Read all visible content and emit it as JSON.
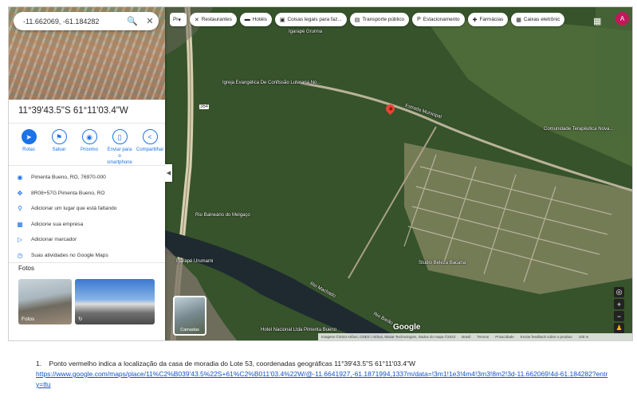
{
  "search": {
    "query": "-11.662069, -61.184282",
    "search_icon": "search-icon",
    "close_icon": "close-icon"
  },
  "place": {
    "title": "11°39'43.5\"S 61°11'03.4\"W"
  },
  "actions": [
    {
      "label": "Rotas",
      "icon": "directions-icon"
    },
    {
      "label": "Salvar",
      "icon": "bookmark-icon"
    },
    {
      "label": "Próximo",
      "icon": "nearby-icon"
    },
    {
      "label": "Enviar para o smartphone",
      "icon": "send-phone-icon"
    },
    {
      "label": "Compartilhar",
      "icon": "share-icon"
    }
  ],
  "info_rows": [
    {
      "text": "Pimenta Bueno, RO, 76970-000",
      "icon": "location-pin-icon"
    },
    {
      "text": "8R08+57G Pimenta Bueno, RO",
      "icon": "plus-code-icon"
    },
    {
      "text": "Adicionar um lugar que está faltando",
      "icon": "add-place-icon"
    },
    {
      "text": "Adicione sua empresa",
      "icon": "business-icon"
    },
    {
      "text": "Adicionar marcador",
      "icon": "label-icon"
    },
    {
      "text": "Suas atividades no Google Maps",
      "icon": "history-icon"
    }
  ],
  "photos": {
    "heading": "Fotos",
    "thumb1": "Fotos",
    "thumb2": ""
  },
  "chips": [
    {
      "label": "Restaurantes",
      "icon": "restaurant-icon"
    },
    {
      "label": "Hotéis",
      "icon": "hotel-icon"
    },
    {
      "label": "Coisas legais para faz...",
      "icon": "attractions-icon"
    },
    {
      "label": "Transporte público",
      "icon": "transit-icon"
    },
    {
      "label": "Estacionamento",
      "icon": "parking-icon"
    },
    {
      "label": "Farmácias",
      "icon": "pharmacy-icon"
    },
    {
      "label": "Caixas eletrônic",
      "icon": "atm-icon"
    }
  ],
  "chip_first": "Pr",
  "avatar": "A",
  "map_labels": {
    "igreja": "Igreja Evangélica De Confissão Luterana No...",
    "igarape_grunna": "Igarapé Grunna",
    "estrada": "Estrada Municipal",
    "comunidade": "Comunidade Terapêutica Nova...",
    "balneario": "Rio Balneário do Melgaço",
    "igarape_urumami": "Igarapé Urumami",
    "rio_machado": "Rio Machado",
    "rio_barao": "Rio Barão",
    "studio": "Studio Beleza Bacana",
    "hotel": "Hotel Nacional Ltda Pimenta Bueno",
    "route": "364"
  },
  "layers": {
    "label": "Camadas"
  },
  "brand": "Google",
  "attribution": [
    "Imagens ©2023 Airbus, CNES / Airbus, Maxar Technologies, Dados do mapa ©2023",
    "Brasil",
    "Termos",
    "Privacidade",
    "Enviar feedback sobre o produto",
    "100 m"
  ],
  "caption": {
    "number": "1.",
    "text": "Ponto vermelho indica a localização da casa de moradia do Lote 53, coordenadas geográficas 11°39'43.5\"S 61°11'03.4\"W",
    "link": "https://www.google.com/maps/place/11%C2%B039'43.5%22S+61%C2%B011'03.4%22W/@-11.6641927,-61.1871994,1337m/data=!3m1!1e3!4m4!3m3!8m2!3d-11.662069!4d-61.184282?entry=ttu"
  },
  "colors": {
    "accent": "#1a73e8",
    "pin": "#ea4335",
    "avatar": "#c2185b"
  }
}
